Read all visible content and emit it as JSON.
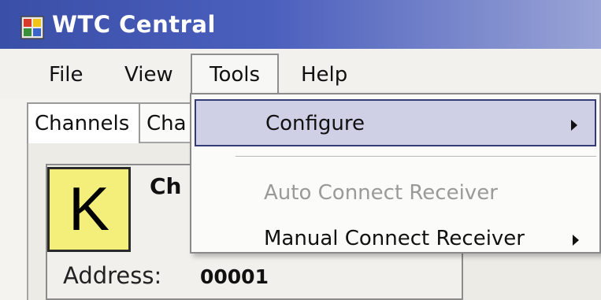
{
  "window": {
    "title": "WTC Central",
    "icon": "app-grid-icon",
    "title_bar_colors": [
      "#3a4fa7",
      "#9aa4d6"
    ]
  },
  "menubar": {
    "items": [
      {
        "label": "File"
      },
      {
        "label": "View"
      },
      {
        "label": "Tools",
        "open": true
      },
      {
        "label": "Help"
      }
    ]
  },
  "tabs": [
    {
      "label": "Channels",
      "active": true
    },
    {
      "label": "Cha"
    }
  ],
  "channel": {
    "letter": "K",
    "name_partial": "Ch",
    "address_label": "Address:",
    "address_value": "00001",
    "letter_bg": "#f4ef7a"
  },
  "tools_menu": {
    "items": [
      {
        "label": "Configure",
        "submenu": true,
        "highlighted": true,
        "enabled": true
      },
      {
        "label": "Auto Connect Receiver",
        "submenu": false,
        "enabled": false
      },
      {
        "label": "Manual Connect Receiver",
        "submenu": true,
        "enabled": true
      }
    ],
    "highlight_color": "#cfd0e6"
  }
}
